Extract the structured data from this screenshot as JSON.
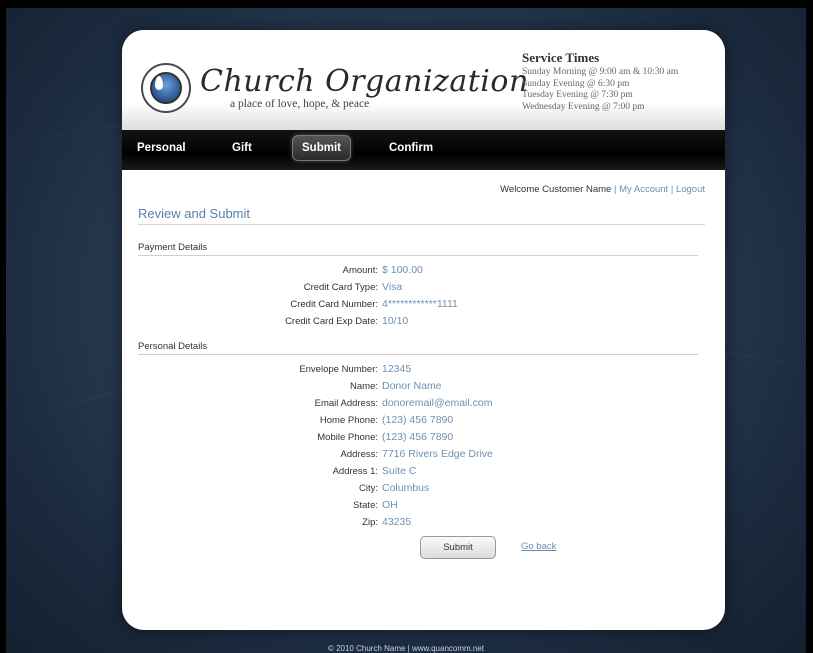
{
  "brand": {
    "name": "Church Organization",
    "tagline": "a place of love, hope, & peace"
  },
  "service_times": {
    "title": "Service Times",
    "lines": [
      "Sunday Morning @ 9:00 am & 10:30 am",
      "Sunday Evening @ 6:30 pm",
      "Tuesday Evening @ 7:30 pm",
      "Wednesday Evening @ 7:00 pm"
    ]
  },
  "nav": {
    "items": [
      "Personal",
      "Gift",
      "Submit",
      "Confirm"
    ],
    "active": "Submit"
  },
  "welcome": {
    "text": "Welcome Customer Name",
    "separator": "|",
    "my_account": "My Account",
    "logout": "Logout"
  },
  "page_title": "Review and Submit",
  "payment": {
    "heading": "Payment Details",
    "rows": [
      {
        "label": "Amount:",
        "value": "$ 100.00"
      },
      {
        "label": "Credit Card Type:",
        "value": "Visa"
      },
      {
        "label": "Credit Card Number:",
        "value": "4************1111"
      },
      {
        "label": "Credit Card Exp Date:",
        "value": "10/10"
      }
    ]
  },
  "personal": {
    "heading": "Personal Details",
    "rows": [
      {
        "label": "Envelope Number:",
        "value": "12345"
      },
      {
        "label": "Name:",
        "value": "Donor Name"
      },
      {
        "label": "Email Address:",
        "value": "donoremail@email.com"
      },
      {
        "label": "Home Phone:",
        "value": "(123) 456 7890"
      },
      {
        "label": "Mobile Phone:",
        "value": "(123) 456 7890"
      },
      {
        "label": "Address:",
        "value": "7716 Rivers Edge Drive"
      },
      {
        "label": "Address 1:",
        "value": "Suite C"
      },
      {
        "label": "City:",
        "value": "Columbus"
      },
      {
        "label": "State:",
        "value": "OH"
      },
      {
        "label": "Zip:",
        "value": "43235"
      }
    ]
  },
  "actions": {
    "submit_label": "Submit",
    "go_back_label": "Go back"
  },
  "footer": "© 2010 Church Name | www.quancomm.net",
  "colors": {
    "link": "#6b8fb5",
    "value": "#6f90b3",
    "background": "#2a3f58"
  },
  "icons": {
    "logo": "dove-flame-emblem-icon"
  }
}
